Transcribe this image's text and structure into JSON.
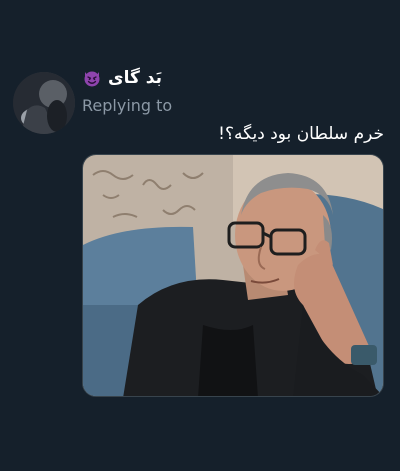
{
  "tweet": {
    "display_name": "بَد گای",
    "name_emoji": "smiling-devil-icon",
    "replying_to": "Replying to",
    "text": "خرم سلطان بود دیگه؟!"
  },
  "media": {
    "type": "photo",
    "subject": "meme-photo"
  },
  "colors": {
    "background": "#15202b",
    "text": "#ffffff",
    "muted": "#8b98a5",
    "emoji": "#8e44ad"
  }
}
